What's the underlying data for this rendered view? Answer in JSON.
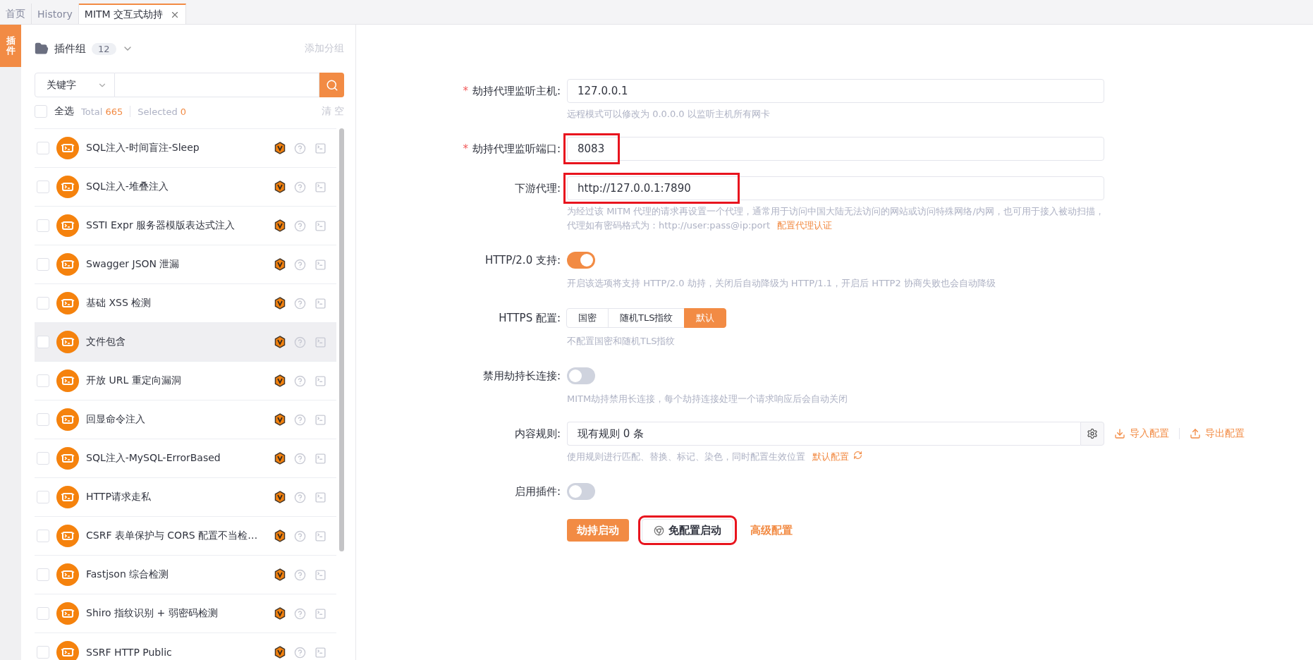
{
  "tabs": [
    {
      "label": "首页",
      "selected": false,
      "closable": false
    },
    {
      "label": "History",
      "selected": false,
      "closable": false
    },
    {
      "label": "MITM 交互式劫持",
      "selected": true,
      "closable": true
    }
  ],
  "side_tabs": [
    {
      "label": "插件",
      "selected": true
    }
  ],
  "plugin_panel": {
    "group_label": "插件组",
    "group_count": "12",
    "add_group": "添加分组",
    "filter_select": "关键字",
    "select_all": {
      "label": "全选",
      "checked": false
    },
    "total_label": "Total",
    "total": "665",
    "selected_label": "Selected",
    "selected_count": "0",
    "clear": "清 空",
    "plugins": [
      {
        "name": "SQL注入-时间盲注-Sleep",
        "checked": false,
        "hovered": false
      },
      {
        "name": "SQL注入-堆叠注入",
        "checked": false,
        "hovered": false
      },
      {
        "name": "SSTI Expr 服务器模版表达式注入",
        "checked": false,
        "hovered": false
      },
      {
        "name": "Swagger JSON 泄漏",
        "checked": false,
        "hovered": false
      },
      {
        "name": "基础 XSS 检测",
        "checked": false,
        "hovered": false
      },
      {
        "name": "文件包含",
        "checked": false,
        "hovered": true
      },
      {
        "name": "开放 URL 重定向漏洞",
        "checked": false,
        "hovered": false
      },
      {
        "name": "回显命令注入",
        "checked": false,
        "hovered": false
      },
      {
        "name": "SQL注入-MySQL-ErrorBased",
        "checked": false,
        "hovered": false
      },
      {
        "name": "HTTP请求走私",
        "checked": false,
        "hovered": false
      },
      {
        "name": "CSRF 表单保护与 CORS 配置不当检…",
        "checked": false,
        "hovered": false
      },
      {
        "name": "Fastjson 综合检测",
        "checked": false,
        "hovered": false
      },
      {
        "name": "Shiro 指纹识别 + 弱密码检测",
        "checked": false,
        "hovered": false
      },
      {
        "name": "SSRF HTTP Public",
        "checked": false,
        "hovered": false
      }
    ]
  },
  "form": {
    "fields": [
      {
        "kind": "input",
        "label": "劫持代理监听主机:",
        "required_mark": "*",
        "value": "127.0.0.1",
        "annotated": false,
        "hint": "远程模式可以修改为 0.0.0.0 以监听主机所有网卡"
      },
      {
        "kind": "input",
        "label": "劫持代理监听端口:",
        "required_mark": "*",
        "value": "8083",
        "annotated": true
      },
      {
        "kind": "input",
        "label": "下游代理:",
        "value": "http://127.0.0.1:7890",
        "annotated": true,
        "hint": "为经过该 MITM 代理的请求再设置一个代理，通常用于访问中国大陆无法访问的网站或访问特殊网络/内网，也可用于接入被动扫描，代理如有密码格式为：http://user:pass@ip:port",
        "hint_link": "配置代理认证"
      },
      {
        "kind": "switch",
        "label": "HTTP/2.0 支持:",
        "on": true,
        "hint": "开启该选项将支持 HTTP/2.0 劫持，关闭后自动降级为 HTTP/1.1，开启后 HTTP2 协商失败也会自动降级"
      },
      {
        "kind": "segmented",
        "label": "HTTPS 配置:",
        "options": [
          {
            "label": "国密",
            "selected": false
          },
          {
            "label": "随机TLS指纹",
            "selected": false
          },
          {
            "label": "默认",
            "selected": true
          }
        ],
        "hint": "不配置国密和随机TLS指纹"
      },
      {
        "kind": "switch",
        "label": "禁用劫持长连接:",
        "on": false,
        "hint": "MITM劫持禁用长连接，每个劫持连接处理一个请求响应后会自动关闭"
      },
      {
        "kind": "rules",
        "label": "内容规则:",
        "value": "现有规则 0 条",
        "import": "导入配置",
        "export": "导出配置",
        "hint": "使用规则进行匹配、替换、标记、染色，同时配置生效位置",
        "hint_link": "默认配置"
      },
      {
        "kind": "switch",
        "label": "启用插件:",
        "on": false
      }
    ],
    "actions": {
      "start": "劫持启动",
      "no_config": {
        "label": "免配置启动",
        "annotated": true
      },
      "advanced": "高级配置"
    }
  }
}
